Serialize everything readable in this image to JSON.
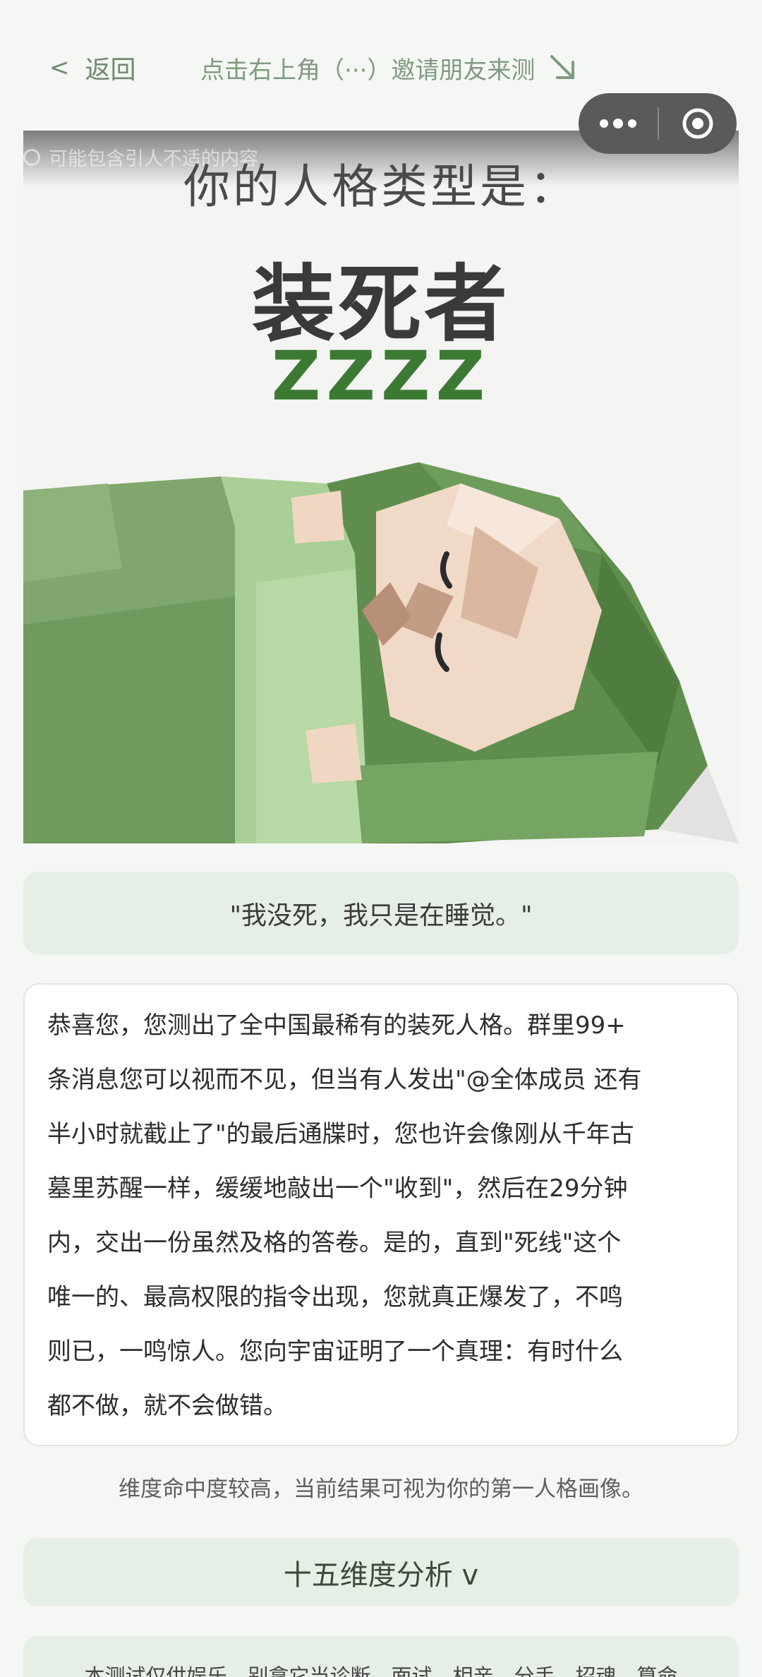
{
  "nav": {
    "back_label": "返回",
    "invite_text": "点击右上角（···）邀请朋友来测"
  },
  "hero": {
    "warning_text": "可能包含引人不适的内容",
    "title": "你的人格类型是：",
    "type_name": "装死者",
    "sleep_text": "ZZZZ"
  },
  "quote": "\"我没死，我只是在睡觉。\"",
  "description_lines": [
    "恭喜您，您测出了全中国最稀有的装死人格。群里99+",
    "条消息您可以视而不见，但当有人发出\"@全体成员 还有",
    "半小时就截止了\"的最后通牒时，您也许会像刚从千年古",
    "墓里苏醒一样，缓缓地敲出一个\"收到\"，然后在29分钟",
    "内，交出一份虽然及格的答卷。是的，直到\"死线\"这个",
    "唯一的、最高权限的指令出现，您就真正爆发了，不鸣",
    "则已，一鸣惊人。您向宇宙证明了一个真理：有时什么",
    "都不做，就不会做错。"
  ],
  "hint": "维度命中度较高，当前结果可视为你的第一人格画像。",
  "analysis_button": "十五维度分析 v",
  "disclaimer": "本测试仅供娱乐，别拿它当诊断、面试、相亲、分手、招魂、算命",
  "colors": {
    "accent_green": "#3c7a34",
    "nav_text": "#6f8a6e",
    "card_bg": "#e6efe5",
    "page_bg": "#f5f7f4"
  }
}
